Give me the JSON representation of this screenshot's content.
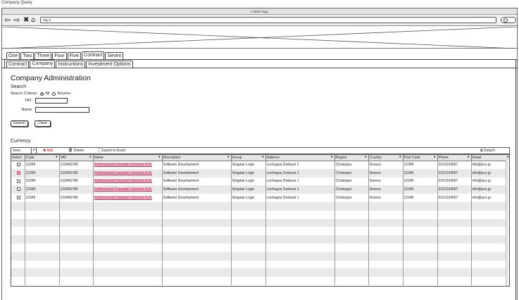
{
  "app_caption": "Company Query",
  "browser": {
    "window_title": "A Web Page",
    "url": "http://",
    "icons": [
      "back-arrow-icon",
      "forward-arrow-icon",
      "close-icon",
      "home-icon",
      "search-icon"
    ]
  },
  "tabs_top": [
    "One",
    "Two",
    "Three",
    "Four",
    "Five",
    "Contract",
    "Seven"
  ],
  "tabs_top_active": "Contract",
  "tabs_sub": [
    "Contract",
    "Company",
    "Instructions",
    "Investment Options"
  ],
  "tabs_sub_active": "Company",
  "page": {
    "title": "Company Administration",
    "search_heading": "Search",
    "criteria_label": "Search Criteria:",
    "criteria_all": "All",
    "criteria_anyone": "Anyone",
    "criteria_selected": "All",
    "vat_label": "VAT",
    "vat_value": "",
    "name_label": "Name",
    "name_value": "",
    "search_button": "Search",
    "clear_button": "Clear",
    "currency_heading": "Currency"
  },
  "toolbar": {
    "view_value": "View",
    "add_label": "Add",
    "delete_label": "Delete",
    "export_label": "Export to Excel",
    "detach_label": "Detach"
  },
  "grid": {
    "columns": [
      "Select",
      "Code",
      "VAT",
      "Name",
      "Description",
      "Group",
      "Address",
      "Region",
      "Country",
      "Post Code",
      "Phone",
      "Email"
    ],
    "rows": [
      {
        "selected": false,
        "code": "12345",
        "vat": "123456789",
        "name": "Professional Computer Services S.A.",
        "description": "Software Development",
        "group": "Singular Logic",
        "address": "Lochagou Dedousi 1",
        "region": "Cholargos",
        "country": "Greece",
        "post_code": "12345",
        "phone": "2101234567",
        "email": "info@pcs.gr"
      },
      {
        "selected": true,
        "code": "12345",
        "vat": "123456789",
        "name": "Professional Computer Services S.A.",
        "description": "Software Development",
        "group": "Singular Logic",
        "address": "Lochagou Dedousi 1",
        "region": "Cholargos",
        "country": "Greece",
        "post_code": "12345",
        "phone": "2101234567",
        "email": "info@pcs.gr"
      },
      {
        "selected": false,
        "code": "12345",
        "vat": "123456789",
        "name": "Professional Computer Services S.A.",
        "description": "Software Development",
        "group": "Singular Logic",
        "address": "Lochagou Dedousi 1",
        "region": "Cholargos",
        "country": "Greece",
        "post_code": "12345",
        "phone": "2101234567",
        "email": "info@pcs.gr"
      },
      {
        "selected": false,
        "code": "12345",
        "vat": "123456789",
        "name": "Professional Computer Services S.A.",
        "description": "Software Development",
        "group": "Singular Logic",
        "address": "Lochagou Dedousi 1",
        "region": "Cholargos",
        "country": "Greece",
        "post_code": "12345",
        "phone": "2101234567",
        "email": "info@pcs.gr"
      },
      {
        "selected": false,
        "code": "12345",
        "vat": "123456789",
        "name": "Professional Computer Services S.A.",
        "description": "Software Development",
        "group": "Singular Logic",
        "address": "Lochagou Dedousi 1",
        "region": "Cholargos",
        "country": "Greece",
        "post_code": "12345",
        "phone": "2101234567",
        "email": "info@pcs.gr"
      }
    ]
  },
  "colors": {
    "selected_row_accent": "#c2476f",
    "link_highlight": "#ecb6c9",
    "add_accent": "#cc0000"
  }
}
